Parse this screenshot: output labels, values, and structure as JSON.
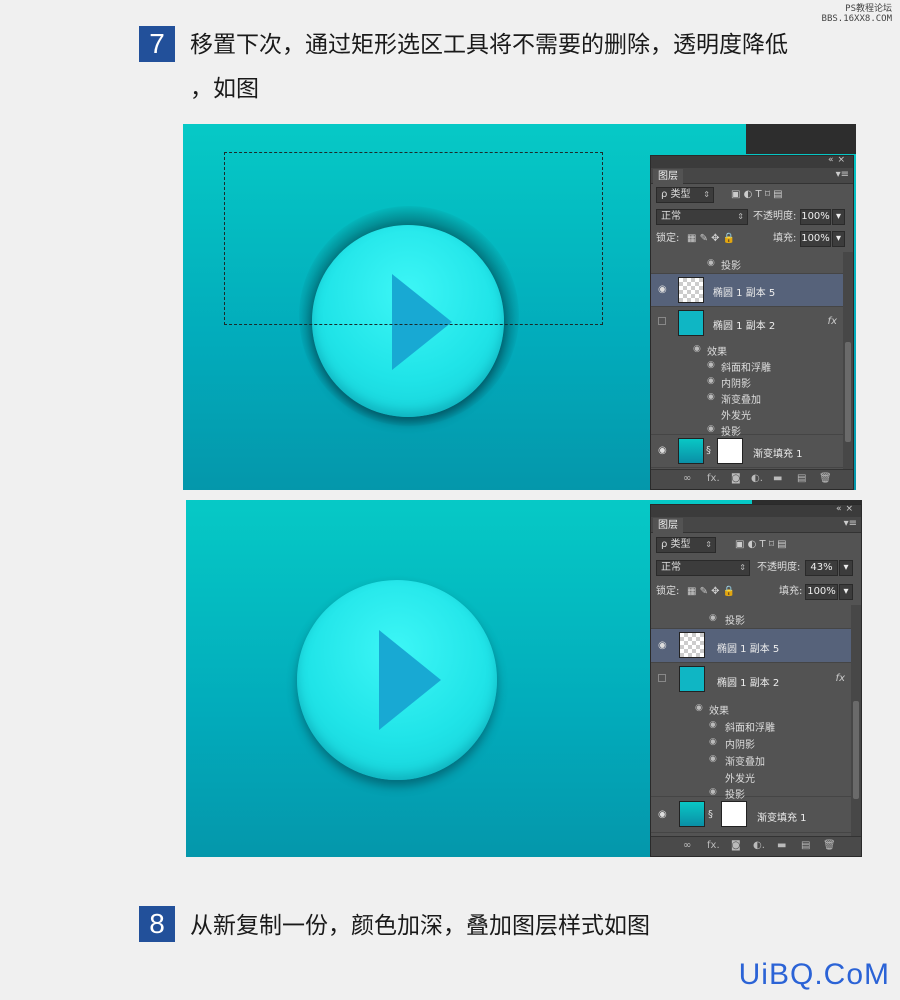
{
  "watermark_top": [
    "PS教程论坛",
    "BBS.16XX8.COM"
  ],
  "watermark_bottom": "UiBQ.CoM",
  "step7": {
    "number": "7",
    "line1": "移置下次，通过矩形选区工具将不需要的删除，透明度降低",
    "line2": "，如图"
  },
  "step8": {
    "number": "8",
    "text": "从新复制一份，颜色加深，叠加图层样式如图"
  },
  "panel": {
    "tab": "图层",
    "filter_label": "ρ 类型",
    "blend_mode": "正常",
    "opacity_label": "不透明度:",
    "lock_label": "锁定:",
    "fill_label": "填充:",
    "fill_value": "100%",
    "layer_top_sub": "投影",
    "layer_selected": "椭圆 1 副本 5",
    "layer_second": "椭圆 1 副本 2",
    "effects_label": "效果",
    "effects": [
      "斜面和浮雕",
      "内阴影",
      "渐变叠加",
      "外发光",
      "投影"
    ],
    "layer_fill": "渐变填充 1",
    "fx_label": "fx"
  },
  "panel1_opacity": "100%",
  "panel2_opacity": "43%",
  "colors": {
    "badge": "#22509a",
    "canvas_top": "#06c9c6",
    "canvas_bottom": "#0497ab",
    "button": "#20e4e8",
    "play": "#18a9d3",
    "watermark": "#2b63d6"
  }
}
